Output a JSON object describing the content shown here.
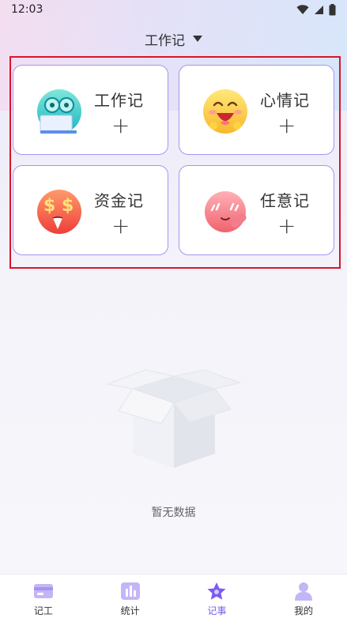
{
  "status_bar": {
    "time": "12:03"
  },
  "header": {
    "title": "工作记"
  },
  "cards": [
    {
      "label": "工作记",
      "plus": "+",
      "icon": "owl-laptop-icon"
    },
    {
      "label": "心情记",
      "plus": "+",
      "icon": "happy-face-icon"
    },
    {
      "label": "资金记",
      "plus": "+",
      "icon": "money-face-icon"
    },
    {
      "label": "任意记",
      "plus": "+",
      "icon": "blush-face-icon"
    }
  ],
  "empty_state": {
    "text": "暂无数据"
  },
  "tabbar": {
    "items": [
      {
        "label": "记工",
        "icon": "card-icon"
      },
      {
        "label": "统计",
        "icon": "chart-icon"
      },
      {
        "label": "记事",
        "icon": "star-icon",
        "active": true
      },
      {
        "label": "我的",
        "icon": "person-icon"
      }
    ]
  },
  "colors": {
    "accent": "#7a5cf0",
    "card_border": "#a894ee",
    "highlight": "#d8152b"
  }
}
